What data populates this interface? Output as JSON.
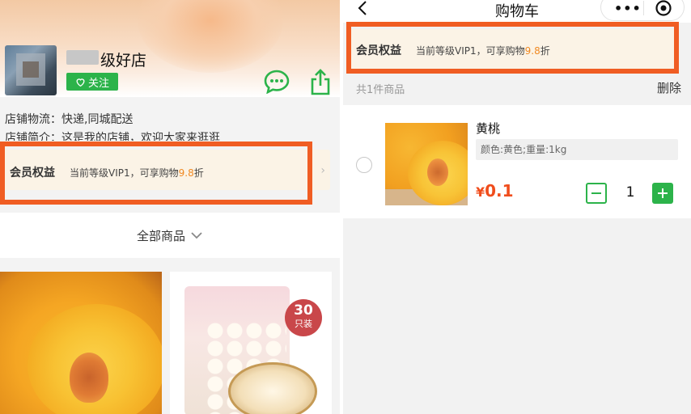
{
  "shop_page": {
    "shop_name": "级好店",
    "follow_label": "关注",
    "logistics": "店铺物流：快递,同城配送",
    "intro": "店铺简介：这是我的店铺，欢迎大家来逛逛",
    "vip": {
      "title": "会员权益",
      "desc_prefix": "当前等级VIP1，可享购物",
      "discount": "9.8",
      "desc_suffix": "折"
    },
    "all_goods_label": "全部商品",
    "products": [
      {
        "badge_number": "30",
        "badge_unit": "只装"
      }
    ]
  },
  "cart": {
    "title": "购物车",
    "vip": {
      "title": "会员权益",
      "desc_prefix": "当前等级VIP1，可享购物",
      "discount": "9.8",
      "desc_suffix": "折"
    },
    "item_count": "共1件商品",
    "delete_label": "删除",
    "items": [
      {
        "name": "黄桃",
        "spec": "颜色:黄色;重量:1kg",
        "currency": "¥",
        "price": "0.1",
        "quantity": "1"
      }
    ]
  },
  "colors": {
    "accent_green": "#2cb34a",
    "highlight_orange": "#f05d23",
    "price_red": "#f04d1c",
    "discount_orange": "#f08a24"
  }
}
